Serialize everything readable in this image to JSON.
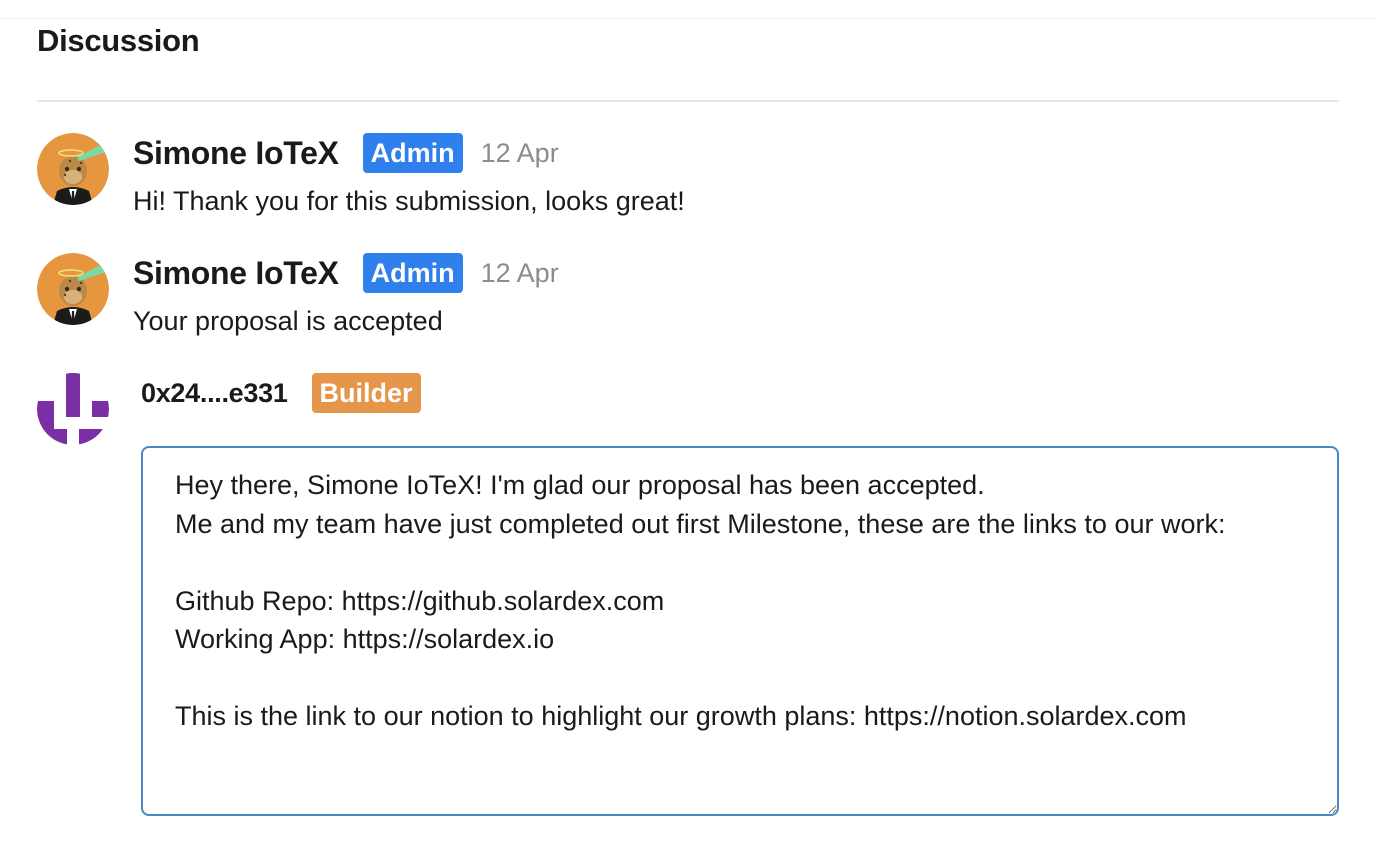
{
  "discussion": {
    "title": "Discussion"
  },
  "comments": [
    {
      "author": "Simone IoTeX",
      "badge": "Admin",
      "date": "12 Apr",
      "text": "Hi! Thank you for this submission, looks great!"
    },
    {
      "author": "Simone IoTeX",
      "badge": "Admin",
      "date": "12 Apr",
      "text": "Your proposal is accepted"
    }
  ],
  "reply": {
    "author": "0x24....e331",
    "badge": "Builder",
    "text": "Hey there, Simone IoTeX! I'm glad our proposal has been accepted.\nMe and my team have just completed out first Milestone, these are the links to our work:\n\nGithub Repo: https://github.solardex.com\nWorking App: https://solardex.io\n\nThis is the link to our notion to highlight our growth plans: https://notion.solardex.com"
  },
  "colors": {
    "admin_badge": "#2f80ed",
    "builder_badge": "#e5964b",
    "admin_avatar_bg": "#e5963f",
    "builder_avatar": "#7b2fa5",
    "reply_border": "#4a86c8"
  },
  "icons": {
    "admin_avatar": "ape-avatar",
    "builder_avatar": "identicon-avatar",
    "resize_handle": "resize-grip-icon"
  }
}
